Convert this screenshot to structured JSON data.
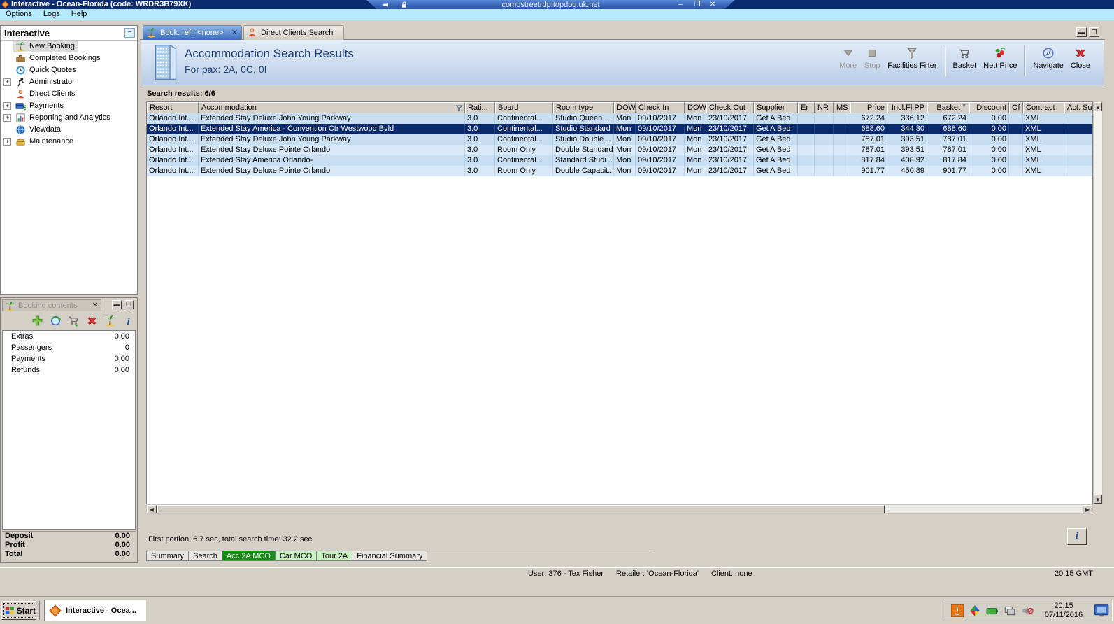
{
  "rdp_bar": {
    "host": "comostreetrdp.topdog.uk.net",
    "buttons": {
      "minimize": "–",
      "restore": "❐",
      "close": "✕"
    }
  },
  "window": {
    "title": "Interactive - Ocean-Florida (code: WRDR3B79XK)"
  },
  "menu_bar": {
    "items": [
      "Options",
      "Logs",
      "Help"
    ]
  },
  "sidebar": {
    "title": "Interactive",
    "collapse_glyph": "−",
    "items": [
      {
        "label": "New Booking",
        "icon": "palm-icon",
        "expandable": false,
        "selected": true
      },
      {
        "label": "Completed Bookings",
        "icon": "bookings-icon",
        "expandable": false,
        "selected": false
      },
      {
        "label": "Quick Quotes",
        "icon": "quotes-icon",
        "expandable": false,
        "selected": false
      },
      {
        "label": "Administrator",
        "icon": "admin-icon",
        "expandable": true,
        "selected": false
      },
      {
        "label": "Direct Clients",
        "icon": "clients-icon",
        "expandable": false,
        "selected": false
      },
      {
        "label": "Payments",
        "icon": "payments-icon",
        "expandable": true,
        "selected": false
      },
      {
        "label": "Reporting and Analytics",
        "icon": "reporting-icon",
        "expandable": true,
        "selected": false
      },
      {
        "label": "Viewdata",
        "icon": "viewdata-icon",
        "expandable": false,
        "selected": false
      },
      {
        "label": "Maintenance",
        "icon": "maintenance-icon",
        "expandable": true,
        "selected": false
      }
    ]
  },
  "booking_contents": {
    "title": "Booking contents",
    "close_glyph": "✕",
    "window_buttons": [
      "▬",
      "❒"
    ],
    "toolbar_icons": [
      {
        "name": "add-item-icon",
        "icon": "plus-icon"
      },
      {
        "name": "refresh-quote-icon",
        "icon": "refresh-globe-icon"
      },
      {
        "name": "move-to-cart-icon",
        "icon": "cart-arrow-icon"
      },
      {
        "name": "delete-item-icon",
        "icon": "delete-x-icon"
      },
      {
        "name": "holiday-icon",
        "icon": "palm-icon"
      },
      {
        "name": "info-icon",
        "icon": "info-icon"
      }
    ],
    "rows": [
      {
        "label": "Extras",
        "value": "0.00"
      },
      {
        "label": "Passengers",
        "value": "0"
      },
      {
        "label": "Payments",
        "value": "0.00"
      },
      {
        "label": "Refunds",
        "value": "0.00"
      }
    ],
    "totals": [
      {
        "label": "Deposit",
        "value": "0.00"
      },
      {
        "label": "Profit",
        "value": "0.00"
      },
      {
        "label": "Total",
        "value": "0.00"
      }
    ]
  },
  "doc_tabs": [
    {
      "label": "Book. ref.: <none>",
      "icon": "palm-icon",
      "active": true,
      "closable": true
    },
    {
      "label": "Direct Clients Search",
      "icon": "clients-icon",
      "active": false,
      "closable": false
    }
  ],
  "mdi_buttons": [
    "▬",
    "❒"
  ],
  "header": {
    "title": "Accommodation Search Results",
    "subtitle": "For pax: 2A, 0C, 0I",
    "toolbar": [
      {
        "label": "More",
        "icon": "more-icon",
        "disabled": true,
        "sep_before": false
      },
      {
        "label": "Stop",
        "icon": "stop-icon",
        "disabled": true,
        "sep_before": false
      },
      {
        "label": "Facilities Filter",
        "icon": "funnel-icon",
        "disabled": false,
        "sep_before": false
      },
      {
        "label": "Basket",
        "icon": "basket-icon",
        "disabled": false,
        "sep_before": true
      },
      {
        "label": "Nett Price",
        "icon": "nettprice-icon",
        "disabled": false,
        "sep_before": false
      },
      {
        "label": "Navigate",
        "icon": "navigate-icon",
        "disabled": false,
        "sep_before": true
      },
      {
        "label": "Close",
        "icon": "close-icon",
        "disabled": false,
        "sep_before": false
      }
    ]
  },
  "results": {
    "summary": "Search results: 6/6",
    "columns": [
      "Resort",
      "Accommodation",
      "Rati...",
      "Board",
      "Room type",
      "DOW",
      "Check In",
      "DOW",
      "Check Out",
      "Supplier",
      "Er",
      "NR",
      "MS",
      "Price",
      "Incl.Fl.PP",
      "Basket",
      "Discount",
      "Of",
      "Contract",
      "Act. Su"
    ],
    "filter_column_index": 1,
    "sort_column_index": 15,
    "sort_glyph": "▼",
    "selected_row": 1,
    "rows": [
      [
        "Orlando Int...",
        "Extended Stay Deluxe John Young Parkway",
        "3.0",
        "Continental...",
        "Studio Queen ...",
        "Mon",
        "09/10/2017",
        "Mon",
        "23/10/2017",
        "Get A Bed",
        "",
        "",
        "",
        "672.24",
        "336.12",
        "672.24",
        "0.00",
        "",
        "XML",
        ""
      ],
      [
        "Orlando Int...",
        "Extended Stay America - Convention Ctr Westwood Bvld",
        "3.0",
        "Continental...",
        "Studio Standard",
        "Mon",
        "09/10/2017",
        "Mon",
        "23/10/2017",
        "Get A Bed",
        "",
        "",
        "",
        "688.60",
        "344.30",
        "688.60",
        "0.00",
        "",
        "XML",
        ""
      ],
      [
        "Orlando Int...",
        "Extended Stay Deluxe John Young Parkway",
        "3.0",
        "Continental...",
        "Studio Double ...",
        "Mon",
        "09/10/2017",
        "Mon",
        "23/10/2017",
        "Get A Bed",
        "",
        "",
        "",
        "787.01",
        "393.51",
        "787.01",
        "0.00",
        "",
        "XML",
        ""
      ],
      [
        "Orlando Int...",
        "Extended Stay Deluxe Pointe Orlando",
        "3.0",
        "Room Only",
        "Double Standard",
        "Mon",
        "09/10/2017",
        "Mon",
        "23/10/2017",
        "Get A Bed",
        "",
        "",
        "",
        "787.01",
        "393.51",
        "787.01",
        "0.00",
        "",
        "XML",
        ""
      ],
      [
        "Orlando Int...",
        "Extended Stay America Orlando-",
        "3.0",
        "Continental...",
        "Standard Studi...",
        "Mon",
        "09/10/2017",
        "Mon",
        "23/10/2017",
        "Get A Bed",
        "",
        "",
        "",
        "817.84",
        "408.92",
        "817.84",
        "0.00",
        "",
        "XML",
        ""
      ],
      [
        "Orlando Int...",
        "Extended Stay Deluxe Pointe Orlando",
        "3.0",
        "Room Only",
        "Double Capacit...",
        "Mon",
        "09/10/2017",
        "Mon",
        "23/10/2017",
        "Get A Bed",
        "",
        "",
        "",
        "901.77",
        "450.89",
        "901.77",
        "0.00",
        "",
        "XML",
        ""
      ]
    ],
    "portion_text": "First portion: 6.7 sec, total search time: 32.2 sec",
    "info_glyph": "i"
  },
  "bottom_tabs": [
    {
      "label": "Summary",
      "style": "plain"
    },
    {
      "label": "Search",
      "style": "plain"
    },
    {
      "label": "Acc 2A MCO",
      "style": "green-dark"
    },
    {
      "label": "Car MCO",
      "style": "green-light"
    },
    {
      "label": "Tour 2A",
      "style": "green-light"
    },
    {
      "label": "Financial Summary",
      "style": "plain"
    }
  ],
  "status_bar": {
    "user": "User: 376 - Tex Fisher",
    "retailer": "Retailer: 'Ocean-Florida'",
    "client": "Client: none",
    "time": "20:15 GMT"
  },
  "taskbar": {
    "start_label": "Start",
    "task_label": "Interactive - Ocea...",
    "tray_icons": [
      {
        "name": "java-tray-icon",
        "icon": "java-icon"
      },
      {
        "name": "security-tray-icon",
        "icon": "security-icon"
      },
      {
        "name": "battery-tray-icon",
        "icon": "battery-icon"
      },
      {
        "name": "network-tray-icon",
        "icon": "network-icon"
      },
      {
        "name": "volume-muted-icon",
        "icon": "speaker-icon"
      }
    ],
    "clock_time": "20:15",
    "clock_date": "07/11/2016"
  },
  "colors": {
    "titlebar": "#0c2a6e",
    "menubar": "#b6e9fb",
    "row_odd": "#c8dff3",
    "row_even": "#d7e9f8",
    "row_selected": "#0b2a6b",
    "tab_green_dark": "#178a17",
    "tab_green_light": "#c9efc2"
  }
}
